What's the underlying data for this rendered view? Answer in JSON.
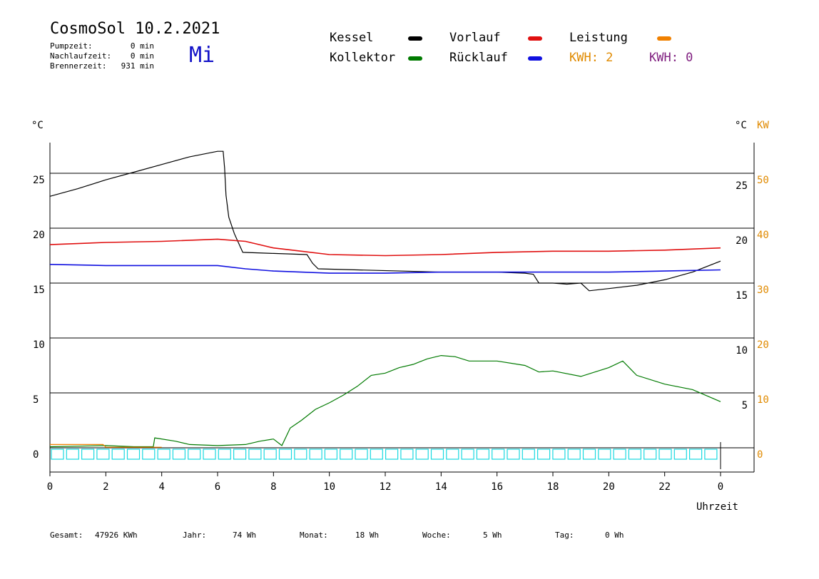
{
  "header": {
    "title": "CosmoSol 10.2.2021",
    "weekday": "Mi",
    "pump": {
      "label": "Pumpzeit:",
      "value": "0 min"
    },
    "after": {
      "label": "Nachlaufzeit:",
      "value": "0 min"
    },
    "burner": {
      "label": "Brennerzeit:",
      "value": "931 min"
    }
  },
  "legend": {
    "kessel": {
      "label": "Kessel",
      "color": "#000000"
    },
    "kollektor": {
      "label": "Kollektor",
      "color": "#007a00"
    },
    "vorlauf": {
      "label": "Vorlauf",
      "color": "#e01010"
    },
    "ruecklauf": {
      "label": "Rücklauf",
      "color": "#1010e0"
    },
    "leistung": {
      "label": "Leistung",
      "color": "#f08000"
    },
    "kwh_a": {
      "label": "KWH: 2",
      "color": "#e08a00"
    },
    "kwh_b": {
      "label": "KWH: 0",
      "color": "#802080"
    }
  },
  "footer": {
    "gesamt": {
      "label": "Gesamt:",
      "value": "47926 KWh"
    },
    "jahr": {
      "label": "Jahr:",
      "value": "74 Wh"
    },
    "monat": {
      "label": "Monat:",
      "value": "18 Wh"
    },
    "woche": {
      "label": "Woche:",
      "value": "5 Wh"
    },
    "tag": {
      "label": "Tag:",
      "value": "0 Wh"
    }
  },
  "chart_data": {
    "type": "line",
    "xlabel": "Uhrzeit",
    "ylabel_left": "°C",
    "ylabel_right_temp": "°C",
    "ylabel_right_power": "KW",
    "xlim": [
      0,
      24
    ],
    "ylim": [
      -2.2,
      27.5
    ],
    "y2lim": [
      -4.4,
      55
    ],
    "x_ticks": [
      {
        "x": 0,
        "label": "0"
      },
      {
        "x": 2,
        "label": "2"
      },
      {
        "x": 4,
        "label": "4"
      },
      {
        "x": 6,
        "label": "6"
      },
      {
        "x": 8,
        "label": "8"
      },
      {
        "x": 10,
        "label": "10"
      },
      {
        "x": 12,
        "label": "12"
      },
      {
        "x": 14,
        "label": "14"
      },
      {
        "x": 16,
        "label": "16"
      },
      {
        "x": 18,
        "label": "18"
      },
      {
        "x": 20,
        "label": "20"
      },
      {
        "x": 22,
        "label": "22"
      },
      {
        "x": 24,
        "label": "0"
      }
    ],
    "y_ticks_left": [
      0,
      5,
      10,
      15,
      20,
      25
    ],
    "y_ticks_right_temp": [
      5,
      10,
      15,
      20,
      25
    ],
    "y_ticks_right_power": [
      0,
      10,
      20,
      30,
      40,
      50
    ],
    "gridlines": [
      0,
      5,
      10,
      15,
      20,
      25
    ],
    "series": [
      {
        "name": "Kessel",
        "color": "#000000",
        "points": [
          [
            0,
            22.9
          ],
          [
            1,
            23.6
          ],
          [
            2,
            24.4
          ],
          [
            3,
            25.1
          ],
          [
            4,
            25.8
          ],
          [
            5,
            26.5
          ],
          [
            6,
            27.0
          ],
          [
            6.2,
            27.0
          ],
          [
            6.25,
            25.5
          ],
          [
            6.3,
            23.0
          ],
          [
            6.4,
            21.0
          ],
          [
            6.6,
            19.5
          ],
          [
            6.9,
            17.8
          ],
          [
            8,
            17.7
          ],
          [
            9.2,
            17.6
          ],
          [
            9.4,
            16.8
          ],
          [
            9.6,
            16.3
          ],
          [
            11,
            16.2
          ],
          [
            14,
            16.0
          ],
          [
            16,
            16.0
          ],
          [
            17,
            15.9
          ],
          [
            17.3,
            15.8
          ],
          [
            17.5,
            15.0
          ],
          [
            18,
            15.0
          ],
          [
            18.5,
            14.9
          ],
          [
            19,
            15.0
          ],
          [
            19.3,
            14.3
          ],
          [
            20,
            14.5
          ],
          [
            21,
            14.8
          ],
          [
            22,
            15.3
          ],
          [
            23,
            16.0
          ],
          [
            24,
            17.0
          ]
        ]
      },
      {
        "name": "Vorlauf",
        "color": "#e01010",
        "points": [
          [
            0,
            18.5
          ],
          [
            2,
            18.7
          ],
          [
            4,
            18.8
          ],
          [
            6,
            19.0
          ],
          [
            7,
            18.8
          ],
          [
            8,
            18.2
          ],
          [
            9,
            17.9
          ],
          [
            10,
            17.6
          ],
          [
            12,
            17.5
          ],
          [
            14,
            17.6
          ],
          [
            16,
            17.8
          ],
          [
            18,
            17.9
          ],
          [
            20,
            17.9
          ],
          [
            22,
            18.0
          ],
          [
            24,
            18.2
          ]
        ]
      },
      {
        "name": "Rücklauf",
        "color": "#1010e0",
        "points": [
          [
            0,
            16.7
          ],
          [
            2,
            16.6
          ],
          [
            4,
            16.6
          ],
          [
            6,
            16.6
          ],
          [
            7,
            16.3
          ],
          [
            8,
            16.1
          ],
          [
            9,
            16.0
          ],
          [
            10,
            15.9
          ],
          [
            12,
            15.9
          ],
          [
            14,
            16.0
          ],
          [
            16,
            16.0
          ],
          [
            18,
            16.0
          ],
          [
            20,
            16.0
          ],
          [
            22,
            16.1
          ],
          [
            24,
            16.2
          ]
        ]
      },
      {
        "name": "Kollektor",
        "color": "#007a00",
        "points": [
          [
            0,
            0.1
          ],
          [
            2,
            0.2
          ],
          [
            3,
            0.1
          ],
          [
            3.7,
            0.1
          ],
          [
            3.75,
            0.9
          ],
          [
            4.5,
            0.6
          ],
          [
            5,
            0.3
          ],
          [
            6,
            0.2
          ],
          [
            7,
            0.3
          ],
          [
            7.5,
            0.6
          ],
          [
            8,
            0.8
          ],
          [
            8.3,
            0.2
          ],
          [
            8.6,
            1.8
          ],
          [
            9,
            2.5
          ],
          [
            9.5,
            3.5
          ],
          [
            10,
            4.1
          ],
          [
            10.5,
            4.8
          ],
          [
            11,
            5.6
          ],
          [
            11.5,
            6.6
          ],
          [
            12,
            6.8
          ],
          [
            12.5,
            7.3
          ],
          [
            13,
            7.6
          ],
          [
            13.5,
            8.1
          ],
          [
            14,
            8.4
          ],
          [
            14.5,
            8.3
          ],
          [
            15,
            7.9
          ],
          [
            16,
            7.9
          ],
          [
            17,
            7.5
          ],
          [
            17.5,
            6.9
          ],
          [
            18,
            7.0
          ],
          [
            19,
            6.5
          ],
          [
            20,
            7.3
          ],
          [
            20.5,
            7.9
          ],
          [
            21,
            6.6
          ],
          [
            22,
            5.8
          ],
          [
            23,
            5.3
          ],
          [
            24,
            4.2
          ]
        ]
      },
      {
        "name": "Leistung",
        "color": "#f08000",
        "points": [
          [
            0,
            0.6
          ],
          [
            1.9,
            0.6
          ],
          [
            2,
            0.1
          ],
          [
            4,
            0.1
          ]
        ]
      }
    ]
  }
}
